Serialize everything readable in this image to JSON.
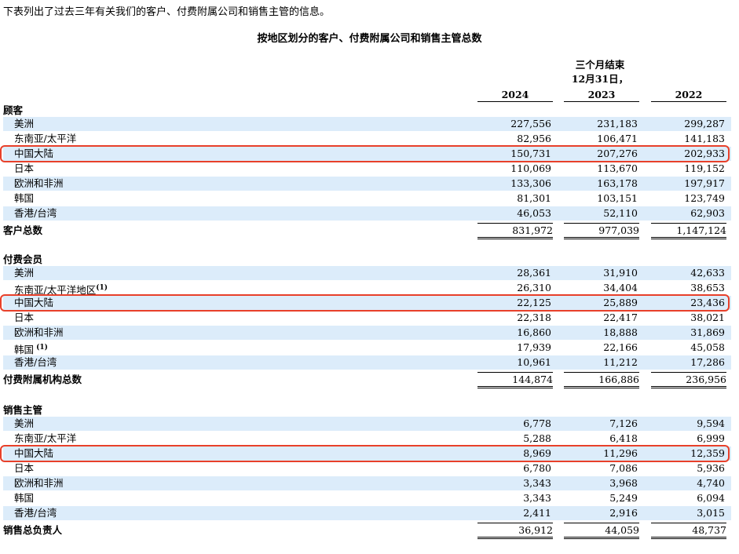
{
  "intro": "下表列出了过去三年有关我们的客户、付费附属公司和销售主管的信息。",
  "caption": "按地区划分的客户、付费附属公司和销售主管总数",
  "header": {
    "line1": "三个月结束",
    "line2": "12月31日，",
    "years": [
      "2024",
      "2023",
      "2022"
    ]
  },
  "sections": [
    {
      "title": "顾客",
      "rows": [
        {
          "label": "美洲",
          "values": [
            "227,556",
            "231,183",
            "299,287"
          ]
        },
        {
          "label": "东南亚/太平洋",
          "values": [
            "82,956",
            "106,471",
            "141,183"
          ]
        },
        {
          "label": "中国大陆",
          "values": [
            "150,731",
            "207,276",
            "202,933"
          ]
        },
        {
          "label": "日本",
          "values": [
            "110,069",
            "113,670",
            "119,152"
          ]
        },
        {
          "label": "欧洲和非洲",
          "values": [
            "133,306",
            "163,178",
            "197,917"
          ]
        },
        {
          "label": "韩国",
          "values": [
            "81,301",
            "103,151",
            "123,749"
          ]
        },
        {
          "label": "香港/台湾",
          "values": [
            "46,053",
            "52,110",
            "62,903"
          ]
        }
      ],
      "total": {
        "label": "客户总数",
        "values": [
          "831,972",
          "977,039",
          "1,147,124"
        ]
      }
    },
    {
      "title": "付费会员",
      "rows": [
        {
          "label": "美洲",
          "values": [
            "28,361",
            "31,910",
            "42,633"
          ]
        },
        {
          "label": "东南亚/太平洋地区",
          "note": "(1)",
          "values": [
            "26,310",
            "34,404",
            "38,653"
          ]
        },
        {
          "label": "中国大陆",
          "values": [
            "22,125",
            "25,889",
            "23,436"
          ]
        },
        {
          "label": "日本",
          "values": [
            "22,318",
            "22,417",
            "38,021"
          ]
        },
        {
          "label": "欧洲和非洲",
          "values": [
            "16,860",
            "18,888",
            "31,869"
          ]
        },
        {
          "label": "韩国",
          "note": " (1)",
          "values": [
            "17,939",
            "22,166",
            "45,058"
          ]
        },
        {
          "label": "香港/台湾",
          "values": [
            "10,961",
            "11,212",
            "17,286"
          ]
        }
      ],
      "total": {
        "label": "付费附属机构总数",
        "values": [
          "144,874",
          "166,886",
          "236,956"
        ]
      }
    },
    {
      "title": "销售主管",
      "rows": [
        {
          "label": "美洲",
          "values": [
            "6,778",
            "7,126",
            "9,594"
          ]
        },
        {
          "label": "东南亚/太平洋",
          "values": [
            "5,288",
            "6,418",
            "6,999"
          ]
        },
        {
          "label": "中国大陆",
          "values": [
            "8,969",
            "11,296",
            "12,359"
          ]
        },
        {
          "label": "日本",
          "values": [
            "6,780",
            "7,086",
            "5,936"
          ]
        },
        {
          "label": "欧洲和非洲",
          "values": [
            "3,343",
            "3,968",
            "4,740"
          ]
        },
        {
          "label": "韩国",
          "values": [
            "3,343",
            "5,249",
            "6,094"
          ]
        },
        {
          "label": "香港/台湾",
          "values": [
            "2,411",
            "2,916",
            "3,015"
          ]
        }
      ],
      "total": {
        "label": "销售总负责人",
        "values": [
          "36,912",
          "44,059",
          "48,737"
        ]
      }
    }
  ],
  "highlight_color": "#e8402a",
  "shade_color": "#dcecfa"
}
